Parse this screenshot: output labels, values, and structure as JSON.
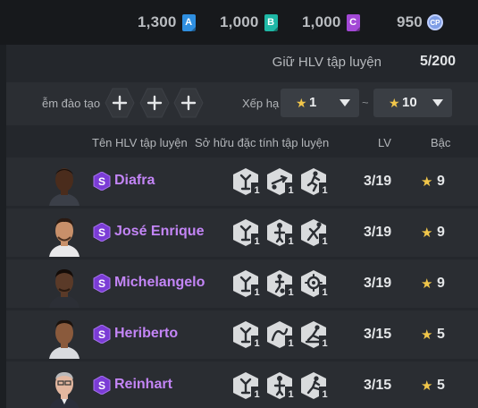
{
  "currencies": [
    {
      "value": "1,300",
      "badge": "A",
      "color": "#2f8fe0",
      "icon": "coupon-a-icon"
    },
    {
      "value": "1,000",
      "badge": "B",
      "color": "#1fb8a6",
      "icon": "coupon-b-icon"
    },
    {
      "value": "1,000",
      "badge": "C",
      "color": "#a348d6",
      "icon": "coupon-c-icon"
    },
    {
      "value": "950",
      "badge": "CP",
      "color": "#7f9ee6",
      "icon": "cp-coin-icon"
    }
  ],
  "hold": {
    "label": "Giữ HLV tập luyện",
    "count": "5/200"
  },
  "filters": {
    "training_label": "ễm đào tạo",
    "slot_icon": "plus-icon",
    "sort_label": "Xếp hạ",
    "rank_from": "1",
    "separator": "~",
    "rank_to": "10"
  },
  "headers": {
    "name": "Tên HLV tập luyện",
    "traits": "Sở hữu đặc tính tập luyện",
    "lv": "LV",
    "rank": "Bậc"
  },
  "coaches": [
    {
      "name": "Diafra",
      "lv": "3/19",
      "rank": "9",
      "trait_levels": [
        "1",
        "1",
        "1"
      ],
      "trait_icons": [
        "fitness-trait-icon",
        "shot-trait-icon",
        "sprint-trait-icon"
      ]
    },
    {
      "name": "José Enrique",
      "lv": "3/19",
      "rank": "9",
      "trait_levels": [
        "1",
        "1",
        "1"
      ],
      "trait_icons": [
        "fitness-trait-icon",
        "header-trait-icon",
        "tackle-trait-icon"
      ]
    },
    {
      "name": "Michelangelo",
      "lv": "3/19",
      "rank": "9",
      "trait_levels": [
        "1",
        "1",
        "1"
      ],
      "trait_icons": [
        "fitness-trait-icon",
        "dribble-trait-icon",
        "vision-trait-icon"
      ]
    },
    {
      "name": "Heriberto",
      "lv": "3/15",
      "rank": "5",
      "trait_levels": [
        "1",
        "1",
        "1"
      ],
      "trait_icons": [
        "fitness-trait-icon",
        "curve-trait-icon",
        "slide-trait-icon"
      ]
    },
    {
      "name": "Reinhart",
      "lv": "3/15",
      "rank": "5",
      "trait_levels": [
        "1",
        "1",
        "1"
      ],
      "trait_icons": [
        "fitness-trait-icon",
        "header-trait-icon",
        "kick-trait-icon"
      ]
    }
  ],
  "colors": {
    "name_purple": "#c385f6",
    "star_gold": "#f1c64a",
    "badge_purple": "#7b3cd6"
  }
}
